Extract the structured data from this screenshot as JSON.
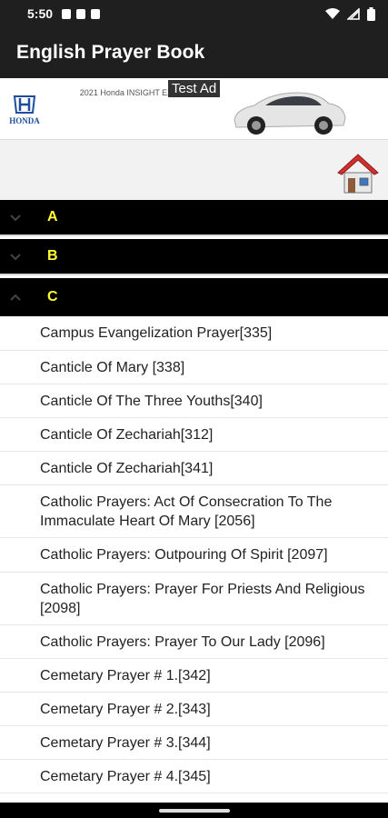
{
  "status": {
    "time": "5:50"
  },
  "app": {
    "title": "English Prayer Book"
  },
  "ad": {
    "brand": "HONDA",
    "text": "2021 Honda INSIGHT EX",
    "badge": "Test Ad"
  },
  "sections": [
    {
      "label": "A",
      "expanded": false
    },
    {
      "label": "B",
      "expanded": false
    },
    {
      "label": "C",
      "expanded": true
    }
  ],
  "items": [
    "Campus Evangelization Prayer[335]",
    "Canticle Of Mary [338]",
    "Canticle Of The Three Youths[340]",
    "Canticle Of Zechariah[312]",
    "Canticle Of Zechariah[341]",
    "Catholic Prayers: Act Of Consecration To The Immaculate Heart Of Mary [2056]",
    "Catholic Prayers: Outpouring Of Spirit [2097]",
    "Catholic Prayers: Prayer For Priests And Religious [2098]",
    "Catholic Prayers: Prayer To Our Lady [2096]",
    "Cemetary Prayer # 1.[342]",
    "Cemetary Prayer # 2.[343]",
    "Cemetary Prayer # 3.[344]",
    "Cemetary Prayer # 4.[345]"
  ]
}
